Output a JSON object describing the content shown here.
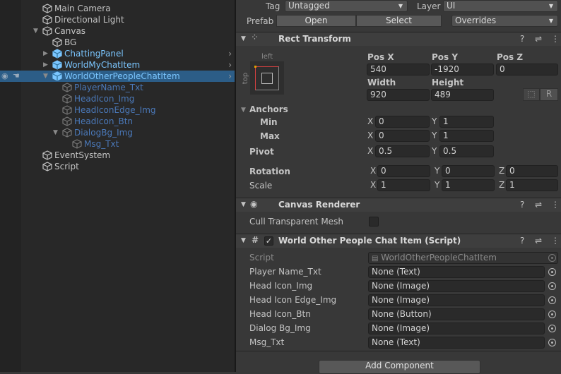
{
  "hierarchy": {
    "items": [
      {
        "label": "Main Camera",
        "depth": 0,
        "expander": "none",
        "prefab": false
      },
      {
        "label": "Directional Light",
        "depth": 0,
        "expander": "none",
        "prefab": false
      },
      {
        "label": "Canvas",
        "depth": 0,
        "expander": "expanded",
        "prefab": false
      },
      {
        "label": "BG",
        "depth": 1,
        "expander": "none",
        "prefab": false
      },
      {
        "label": "ChattingPanel",
        "depth": 1,
        "expander": "collapsed",
        "prefab": true,
        "chevron": true
      },
      {
        "label": "WorldMyChatItem",
        "depth": 1,
        "expander": "collapsed",
        "prefab": true,
        "chevron": true
      },
      {
        "label": "WorldOtherPeopleChatItem",
        "depth": 1,
        "expander": "expanded",
        "prefab": true,
        "chevron": true,
        "selected": true
      },
      {
        "label": "PlayerName_Txt",
        "depth": 2,
        "expander": "none",
        "prefabChild": true
      },
      {
        "label": "HeadIcon_Img",
        "depth": 2,
        "expander": "none",
        "prefabChild": true
      },
      {
        "label": "HeadIconEdge_Img",
        "depth": 2,
        "expander": "none",
        "prefabChild": true
      },
      {
        "label": "HeadIcon_Btn",
        "depth": 2,
        "expander": "none",
        "prefabChild": true
      },
      {
        "label": "DialogBg_Img",
        "depth": 2,
        "expander": "expanded",
        "prefabChild": true
      },
      {
        "label": "Msg_Txt",
        "depth": 3,
        "expander": "none",
        "prefabChild": true
      },
      {
        "label": "EventSystem",
        "depth": 0,
        "expander": "none",
        "prefab": false
      },
      {
        "label": "Script",
        "depth": 0,
        "expander": "none",
        "prefab": false
      }
    ]
  },
  "inspector": {
    "tag_label": "Tag",
    "tag_value": "Untagged",
    "layer_label": "Layer",
    "layer_value": "UI",
    "prefab_label": "Prefab",
    "open": "Open",
    "select": "Select",
    "overrides": "Overrides",
    "rect": {
      "title": "Rect Transform",
      "preset_h": "left",
      "preset_v": "top",
      "posx_label": "Pos X",
      "posy_label": "Pos Y",
      "posz_label": "Pos Z",
      "posx": "540",
      "posy": "-1920",
      "posz": "0",
      "width_label": "Width",
      "height_label": "Height",
      "width": "920",
      "height": "489",
      "raw_btn": "R",
      "anchors": "Anchors",
      "min": "Min",
      "max": "Max",
      "pivot": "Pivot",
      "min_x": "0",
      "min_y": "1",
      "max_x": "0",
      "max_y": "1",
      "pivot_x": "0.5",
      "pivot_y": "0.5",
      "rotation": "Rotation",
      "scale": "Scale",
      "rot_x": "0",
      "rot_y": "0",
      "rot_z": "0",
      "scale_x": "1",
      "scale_y": "1",
      "scale_z": "1",
      "x": "X",
      "y": "Y",
      "z": "Z"
    },
    "canvas_renderer": {
      "title": "Canvas Renderer",
      "cull_label": "Cull Transparent Mesh",
      "cull": false
    },
    "script": {
      "title": "World Other People Chat Item (Script)",
      "enabled": true,
      "script_label": "Script",
      "script_value": "WorldOtherPeopleChatItem",
      "fields": [
        {
          "label": "Player Name_Txt",
          "value": "None (Text)"
        },
        {
          "label": "Head Icon_Img",
          "value": "None (Image)"
        },
        {
          "label": "Head Icon Edge_Img",
          "value": "None (Image)"
        },
        {
          "label": "Head Icon_Btn",
          "value": "None (Button)"
        },
        {
          "label": "Dialog Bg_Img",
          "value": "None (Image)"
        },
        {
          "label": "Msg_Txt",
          "value": "None (Text)"
        }
      ]
    },
    "add_component": "Add Component"
  },
  "colors": {
    "selection": "#2c5d87",
    "prefab": "#7bc6ff",
    "prefab_child": "#4a78b8"
  }
}
